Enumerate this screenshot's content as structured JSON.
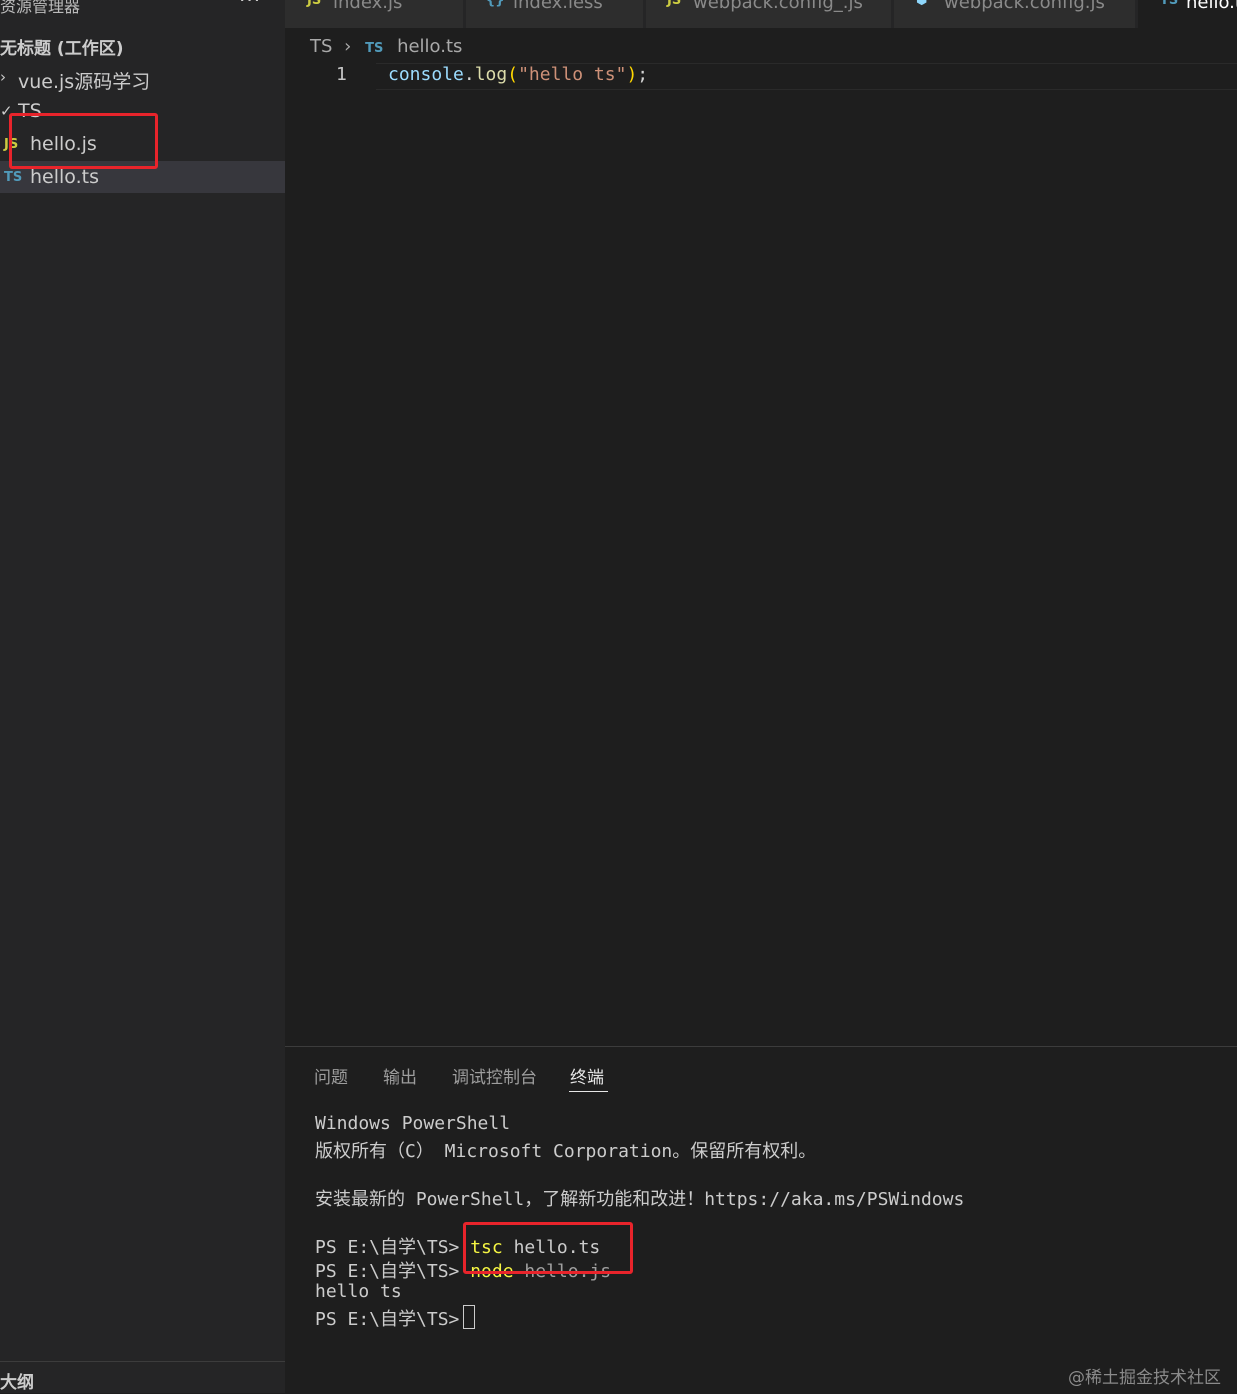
{
  "sidebar": {
    "header": "资源管理器",
    "more": "···",
    "workspace": "无标题 (工作区)",
    "folders": [
      {
        "chevron": "›",
        "label": "vue.js源码学习"
      },
      {
        "chevron": "✓",
        "label": "TS"
      }
    ],
    "files": [
      {
        "icon": "JS",
        "label": "hello.js"
      },
      {
        "icon": "TS",
        "label": "hello.ts"
      }
    ],
    "outline": "大纲"
  },
  "tabs": [
    {
      "icon": "JS",
      "label": "index.js"
    },
    {
      "icon": "{}",
      "label": "index.less"
    },
    {
      "icon": "JS",
      "label": "webpack.config_.js"
    },
    {
      "icon": "⬢",
      "label": "webpack.config.js"
    },
    {
      "icon": "TS",
      "label": "hello.ts"
    }
  ],
  "breadcrumb": {
    "folder": "TS",
    "sep": "›",
    "icon": "TS",
    "file": "hello.ts"
  },
  "editor": {
    "line_number": "1",
    "tokens": {
      "obj": "console",
      "dot": ".",
      "fn": "log",
      "lparen": "(",
      "str": "\"hello ts\"",
      "rparen": ")",
      "semi": ";"
    }
  },
  "panel": {
    "tabs": [
      "问题",
      "输出",
      "调试控制台",
      "终端"
    ],
    "terminal": {
      "line1": "Windows PowerShell",
      "line2": "版权所有（C） Microsoft Corporation。保留所有权利。",
      "line3": "安装最新的 PowerShell，了解新功能和改进！https://aka.ms/PSWindows",
      "prompt": "PS E:\\自学\\TS>",
      "cmd1_bin": "tsc",
      "cmd1_arg": "hello.ts",
      "cmd2_bin": "node",
      "cmd2_arg": "hello.js",
      "output": "hello ts"
    }
  },
  "watermark": "@稀土掘金技术社区",
  "colors": {
    "highlight_box": "#e8242b",
    "js_icon": "#cbcb41",
    "ts_icon": "#519aba"
  }
}
